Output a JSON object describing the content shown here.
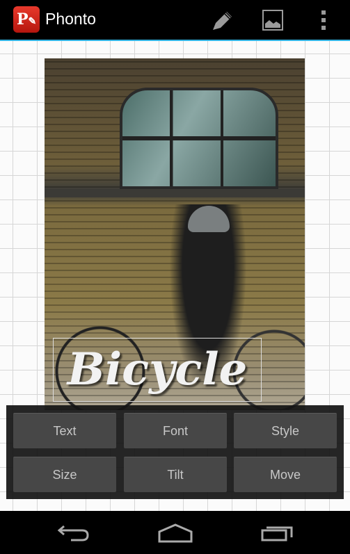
{
  "app": {
    "title": "Phonto",
    "logo_letter": "P",
    "accent": "#33b5e5"
  },
  "actionbar": {
    "icons": [
      "pencil-icon",
      "image-icon",
      "overflow-menu-icon"
    ]
  },
  "photo": {
    "overlay_text": "Bicycle"
  },
  "panel": {
    "buttons": [
      "Text",
      "Font",
      "Style",
      "Size",
      "Tilt",
      "Move"
    ]
  },
  "navbar": {
    "icons": [
      "back-icon",
      "home-icon",
      "recent-apps-icon"
    ]
  }
}
